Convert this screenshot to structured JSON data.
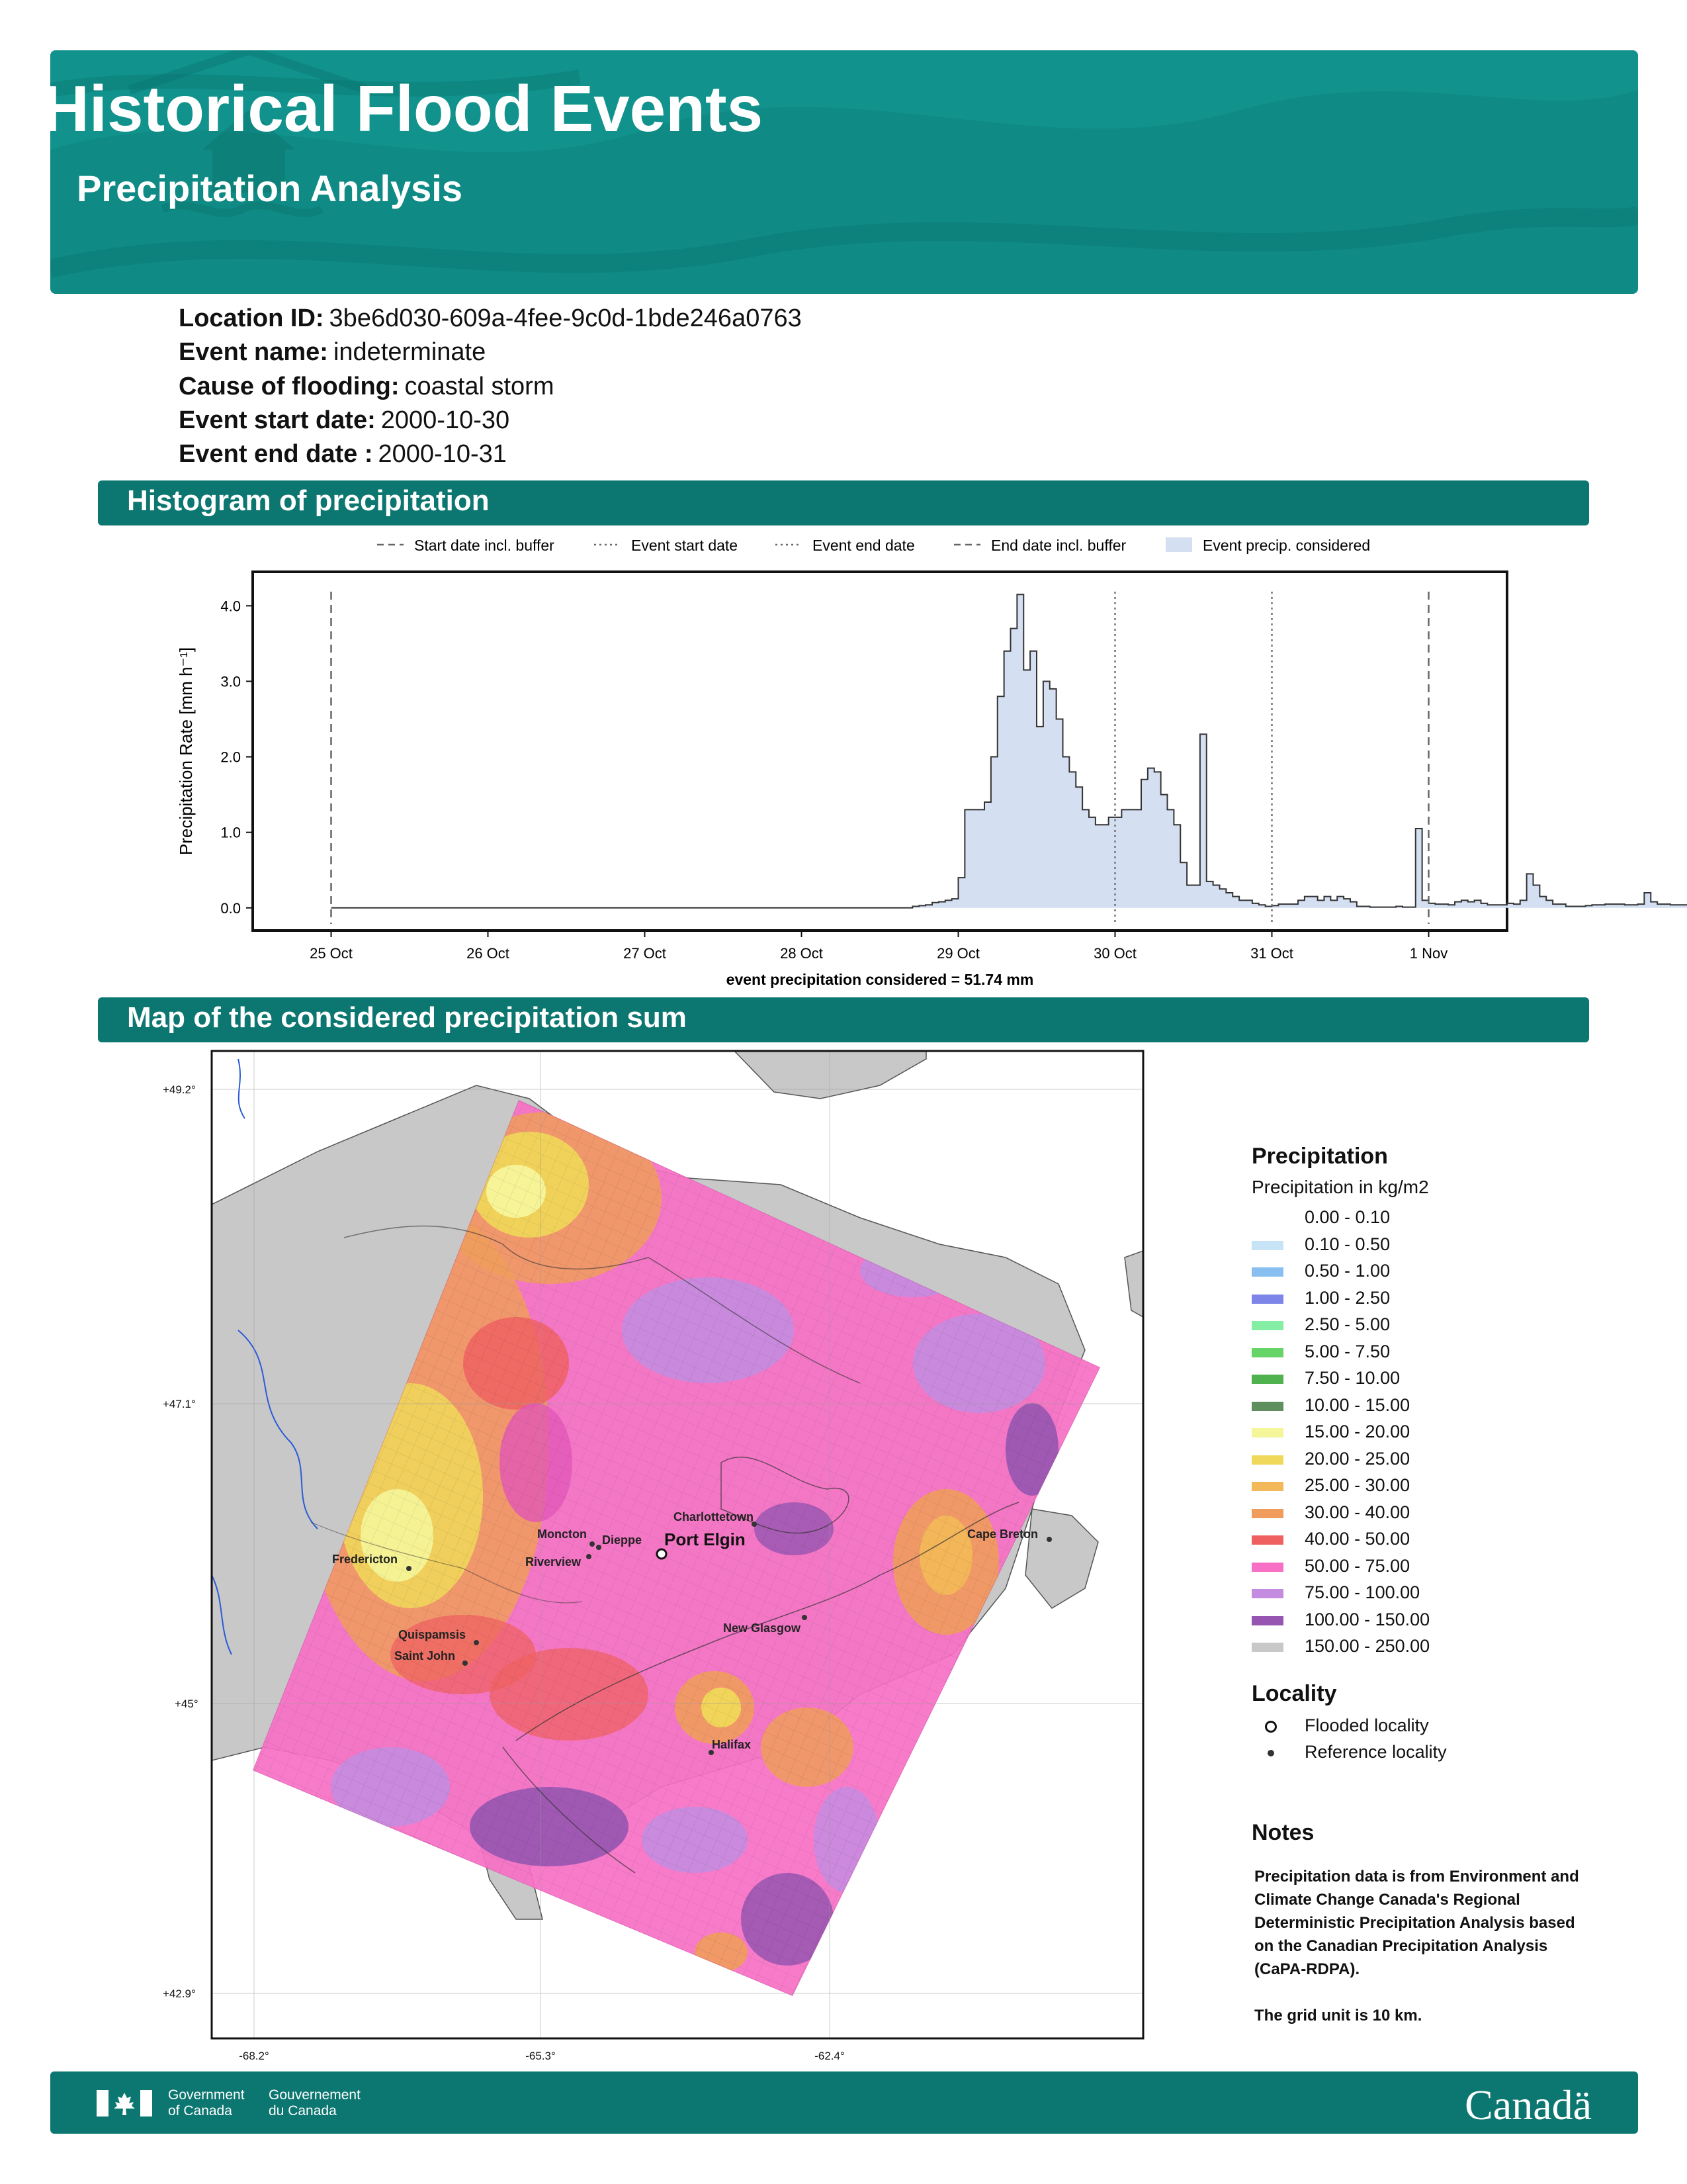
{
  "header": {
    "title": "Historical Flood Events",
    "subtitle": "Precipitation Analysis",
    "colors": {
      "banner": "#0f8a84",
      "section": "#0c7670"
    }
  },
  "info": [
    {
      "label": "Location ID:",
      "value": "3be6d030-609a-4fee-9c0d-1bde246a0763"
    },
    {
      "label": "Event name:",
      "value": "indeterminate"
    },
    {
      "label": "Cause of flooding:",
      "value": "coastal storm"
    },
    {
      "label": "Event start date:",
      "value": "2000-10-30"
    },
    {
      "label": "Event end date :",
      "value": "2000-10-31"
    }
  ],
  "sections": {
    "histogram": "Histogram of precipitation",
    "map": "Map of the considered precipitation sum"
  },
  "chart_data": {
    "type": "bar",
    "ylabel": "Precipitation Rate [mm h⁻¹]",
    "yticks": [
      "0.0",
      "1.0",
      "2.0",
      "3.0",
      "4.0"
    ],
    "ylim": [
      -0.3,
      4.45
    ],
    "x_start": "2000-10-24 12:00",
    "xlim": [
      0,
      8.0
    ],
    "xticks": [
      {
        "at": 0.5,
        "label": "25 Oct"
      },
      {
        "at": 1.5,
        "label": "26 Oct"
      },
      {
        "at": 2.5,
        "label": "27 Oct"
      },
      {
        "at": 3.5,
        "label": "28 Oct"
      },
      {
        "at": 4.5,
        "label": "29 Oct"
      },
      {
        "at": 5.5,
        "label": "30 Oct"
      },
      {
        "at": 6.5,
        "label": "31 Oct"
      },
      {
        "at": 7.5,
        "label": "1 Nov"
      }
    ],
    "xlabel": "event precipitation considered = 51.74 mm",
    "legend": [
      {
        "label": "Start date incl. buffer",
        "style": "dashed"
      },
      {
        "label": "Event start date",
        "style": "dotted"
      },
      {
        "label": "Event end date",
        "style": "dotted"
      },
      {
        "label": "End date incl. buffer",
        "style": "dashed"
      },
      {
        "label": "Event precip. considered",
        "style": "patch"
      }
    ],
    "legend_position": "top",
    "vlines": [
      {
        "at": 0.5,
        "style": "dashed",
        "name": "start-buffer"
      },
      {
        "at": 5.5,
        "style": "dotted",
        "name": "event-start"
      },
      {
        "at": 6.5,
        "style": "dotted",
        "name": "event-end"
      },
      {
        "at": 7.5,
        "style": "dashed",
        "name": "end-buffer"
      }
    ],
    "hourly_bins_from": "2000-10-28 12:00",
    "values": [
      0.0,
      0.0,
      0.0,
      0.0,
      0.0,
      0.02,
      0.03,
      0.04,
      0.07,
      0.08,
      0.1,
      0.12,
      0.4,
      1.3,
      1.3,
      1.3,
      1.4,
      2.0,
      2.8,
      3.4,
      3.7,
      4.15,
      3.15,
      3.4,
      2.4,
      3.0,
      2.9,
      2.5,
      2.0,
      1.8,
      1.6,
      1.3,
      1.2,
      1.1,
      1.1,
      1.2,
      1.2,
      1.3,
      1.3,
      1.3,
      1.7,
      1.85,
      1.8,
      1.5,
      1.3,
      1.1,
      0.6,
      0.3,
      0.3,
      2.3,
      0.35,
      0.3,
      0.25,
      0.2,
      0.15,
      0.1,
      0.1,
      0.06,
      0.04,
      0.02,
      0.03,
      0.05,
      0.05,
      0.05,
      0.1,
      0.15,
      0.15,
      0.1,
      0.15,
      0.1,
      0.15,
      0.12,
      0.08,
      0.02,
      0.02,
      0.01,
      0.01,
      0.01,
      0.01,
      0.02,
      0.01,
      0.01,
      1.05,
      0.1,
      0.06,
      0.05,
      0.05,
      0.04,
      0.08,
      0.1,
      0.08,
      0.1,
      0.06,
      0.04,
      0.04,
      0.04,
      0.06,
      0.05,
      0.1,
      0.45,
      0.3,
      0.15,
      0.1,
      0.05,
      0.05,
      0.02,
      0.02,
      0.02,
      0.03,
      0.04,
      0.04,
      0.05,
      0.05,
      0.05,
      0.04,
      0.04,
      0.05,
      0.2,
      0.08,
      0.05,
      0.05,
      0.04,
      0.04,
      0.04,
      0.03,
      0.03
    ]
  },
  "map": {
    "lat_ticks": [
      "+49.2°",
      "+47.1°",
      "+45°",
      "+42.9°"
    ],
    "lon_ticks": [
      "-68.2°",
      "-65.3°",
      "-62.4°"
    ],
    "flooded_locality": "Port Elgin",
    "reference_localities": [
      "Charlottetown",
      "Moncton",
      "Dieppe",
      "Riverview",
      "Fredericton",
      "Quispamsis",
      "Saint John",
      "New Glasgow",
      "Cape Breton",
      "Halifax"
    ]
  },
  "legend": {
    "title": "Precipitation",
    "subtitle": "Precipitation in kg/m2",
    "bins": [
      {
        "label": "0.00 - 0.10",
        "color": "#ffffff"
      },
      {
        "label": "0.10 - 0.50",
        "color": "#c6e4f6"
      },
      {
        "label": "0.50 - 1.00",
        "color": "#86bff0"
      },
      {
        "label": "1.00 - 2.50",
        "color": "#7d86e8"
      },
      {
        "label": "2.50 - 5.00",
        "color": "#85eea5"
      },
      {
        "label": "5.00 - 7.50",
        "color": "#66d466"
      },
      {
        "label": "7.50 - 10.00",
        "color": "#4fb24f"
      },
      {
        "label": "10.00 - 15.00",
        "color": "#5f8e5f"
      },
      {
        "label": "15.00 - 20.00",
        "color": "#f5f59a"
      },
      {
        "label": "20.00 - 25.00",
        "color": "#f0d85a"
      },
      {
        "label": "25.00 - 30.00",
        "color": "#f2b85a"
      },
      {
        "label": "30.00 - 40.00",
        "color": "#ef9c5c"
      },
      {
        "label": "40.00 - 50.00",
        "color": "#ef6161"
      },
      {
        "label": "50.00 - 75.00",
        "color": "#f770c6"
      },
      {
        "label": "75.00 - 100.00",
        "color": "#c48ce0"
      },
      {
        "label": "100.00 - 150.00",
        "color": "#9655b0"
      },
      {
        "label": "150.00 - 250.00",
        "color": "#c8c8c8"
      }
    ],
    "locality_title": "Locality",
    "flooded_label": "Flooded locality",
    "reference_label": "Reference locality",
    "notes_title": "Notes",
    "notes": [
      "Precipitation data is from Environment and",
      "Climate Change Canada's Regional",
      "Deterministic Precipitation Analysis based",
      "on the Canadian Precipitation Analysis",
      "(CaPA-RDPA).",
      "",
      "The grid unit is 10 km."
    ]
  },
  "footer": {
    "gov_en_1": "Government",
    "gov_en_2": "of Canada",
    "gov_fr_1": "Gouvernement",
    "gov_fr_2": "du Canada",
    "wordmark": "Canadä"
  }
}
